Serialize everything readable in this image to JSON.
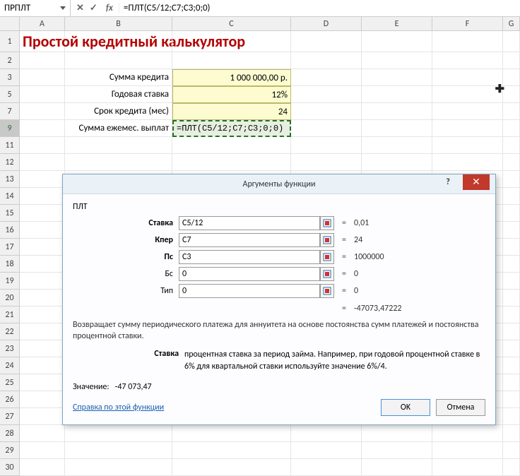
{
  "formula_bar": {
    "name_box": "ПРПЛТ",
    "formula": "=ПЛТ(C5/12;C7;C3;0;0)",
    "cancel_glyph": "✕",
    "accept_glyph": "✓",
    "fx_glyph": "fx"
  },
  "columns": [
    "A",
    "B",
    "C",
    "D",
    "E",
    "F",
    "G"
  ],
  "rows_visible": [
    "1",
    "2",
    "3",
    "5",
    "7",
    "9",
    "11",
    "12",
    "13",
    "14",
    "15",
    "16",
    "17",
    "18",
    "19",
    "20",
    "21",
    "22",
    "23",
    "24",
    "25",
    "26",
    "27",
    "28",
    "29",
    "30"
  ],
  "sheet": {
    "title": "Простой кредитный калькулятор",
    "r3_label": "Сумма кредита",
    "r3_value": "1 000 000,00 р.",
    "r5_label": "Годовая ставка",
    "r5_value": "12%",
    "r7_label": "Срок кредита (мес)",
    "r7_value": "24",
    "r9_label": "Сумма ежемес. выплат",
    "r9_formula": "=ПЛТ(C5/12;C7;C3;0;0)"
  },
  "dialog": {
    "title": "Аргументы функции",
    "func_name": "ПЛТ",
    "args": [
      {
        "label": "Ставка",
        "bold": true,
        "value": "C5/12",
        "result": "0,01"
      },
      {
        "label": "Кпер",
        "bold": true,
        "value": "C7",
        "result": "24"
      },
      {
        "label": "Пс",
        "bold": true,
        "value": "C3",
        "result": "1000000"
      },
      {
        "label": "Бс",
        "bold": false,
        "value": "0",
        "result": "0"
      },
      {
        "label": "Тип",
        "bold": false,
        "value": "0",
        "result": "0"
      }
    ],
    "func_result": "-47073,47222",
    "description": "Возвращает сумму периодического платежа для аннуитета на основе постоянства сумм платежей и постоянства процентной ставки.",
    "param_name": "Ставка",
    "param_text": "процентная ставка за период займа. Например, при годовой процентной ставке в 6% для квартальной ставки используйте значение 6%/4.",
    "value_label": "Значение:",
    "value_result": "-47 073,47",
    "help_link": "Справка по этой функции",
    "ok": "OK",
    "cancel": "Отмена",
    "eq": "="
  }
}
